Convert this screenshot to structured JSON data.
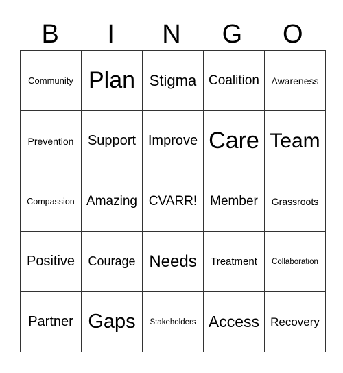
{
  "header": [
    "B",
    "I",
    "N",
    "G",
    "O"
  ],
  "cells": [
    [
      {
        "t": "Community",
        "s": 13
      },
      {
        "t": "Plan",
        "s": 34
      },
      {
        "t": "Stigma",
        "s": 22
      },
      {
        "t": "Coalition",
        "s": 19
      },
      {
        "t": "Awareness",
        "s": 14
      }
    ],
    [
      {
        "t": "Prevention",
        "s": 14
      },
      {
        "t": "Support",
        "s": 20
      },
      {
        "t": "Improve",
        "s": 20
      },
      {
        "t": "Care",
        "s": 34
      },
      {
        "t": "Team",
        "s": 30
      }
    ],
    [
      {
        "t": "Compassion",
        "s": 12.5
      },
      {
        "t": "Amazing",
        "s": 19
      },
      {
        "t": "CVARR!",
        "s": 19
      },
      {
        "t": "Member",
        "s": 19
      },
      {
        "t": "Grassroots",
        "s": 14
      }
    ],
    [
      {
        "t": "Positive",
        "s": 20
      },
      {
        "t": "Courage",
        "s": 18
      },
      {
        "t": "Needs",
        "s": 24
      },
      {
        "t": "Treatment",
        "s": 15
      },
      {
        "t": "Collaboration",
        "s": 11.5
      }
    ],
    [
      {
        "t": "Partner",
        "s": 20
      },
      {
        "t": "Gaps",
        "s": 29
      },
      {
        "t": "Stakeholders",
        "s": 11.5
      },
      {
        "t": "Access",
        "s": 23
      },
      {
        "t": "Recovery",
        "s": 17
      }
    ]
  ]
}
